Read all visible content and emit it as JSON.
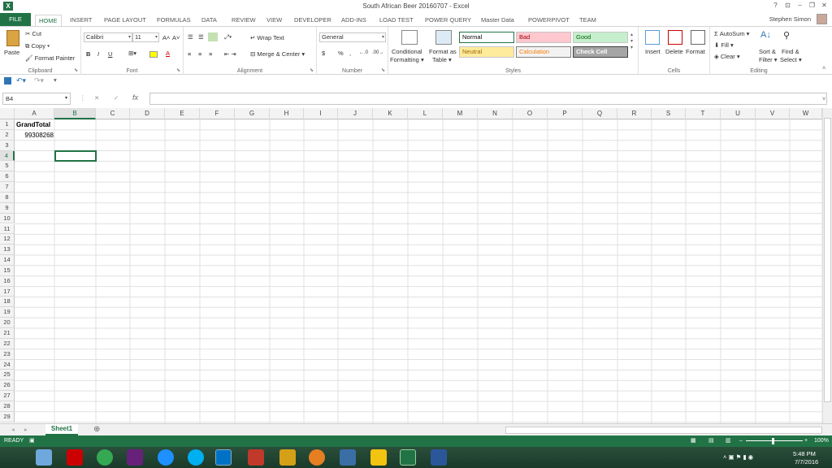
{
  "window": {
    "title": "South African Beer 20160707 - Excel",
    "help": "?",
    "ribbon_display": "⊡",
    "minimize": "–",
    "restore": "❐",
    "close": "✕"
  },
  "tabs": [
    "FILE",
    "HOME",
    "INSERT",
    "PAGE LAYOUT",
    "FORMULAS",
    "DATA",
    "REVIEW",
    "VIEW",
    "DEVELOPER",
    "ADD-INS",
    "LOAD TEST",
    "POWER QUERY",
    "Master Data",
    "POWERPIVOT",
    "TEAM"
  ],
  "user": {
    "name": "Stephen Simon"
  },
  "clipboard": {
    "paste": "Paste",
    "cut": "Cut",
    "copy": "Copy",
    "format_painter": "Format Painter",
    "label": "Clipboard"
  },
  "font": {
    "name": "Calibri",
    "size": "11",
    "bold": "B",
    "italic": "I",
    "underline": "U",
    "grow": "A˄",
    "shrink": "A˅",
    "font_color": "A",
    "label": "Font"
  },
  "alignment": {
    "wrap": "Wrap Text",
    "merge": "Merge & Center",
    "label": "Alignment"
  },
  "number": {
    "format": "General",
    "currency": "$",
    "percent": "%",
    "comma": ",",
    "inc": "←.0",
    "dec": ".00→",
    "label": "Number"
  },
  "styles": {
    "conditional": "Conditional",
    "conditional2": "Formatting",
    "format_as": "Format as",
    "format_as2": "Table",
    "cells": [
      {
        "label": "Normal",
        "bg": "#ffffff",
        "fg": "#000000",
        "border": "#217346"
      },
      {
        "label": "Bad",
        "bg": "#ffc7ce",
        "fg": "#9c0006",
        "border": "#c6c6c6"
      },
      {
        "label": "Good",
        "bg": "#c6efce",
        "fg": "#006100",
        "border": "#c6c6c6"
      },
      {
        "label": "Neutral",
        "bg": "#ffeb9c",
        "fg": "#9c6500",
        "border": "#c6c6c6"
      },
      {
        "label": "Calculation",
        "bg": "#f2f2f2",
        "fg": "#fa7d00",
        "border": "#7f7f7f"
      },
      {
        "label": "Check Cell",
        "bg": "#a5a5a5",
        "fg": "#ffffff",
        "border": "#3f3f3f"
      }
    ],
    "label": "Styles"
  },
  "cells_group": {
    "insert": "Insert",
    "delete": "Delete",
    "format": "Format",
    "label": "Cells"
  },
  "editing": {
    "autosum": "AutoSum",
    "fill": "Fill",
    "clear": "Clear",
    "sort": "Sort &",
    "sort2": "Filter",
    "find": "Find &",
    "find2": "Select",
    "label": "Editing"
  },
  "formula_bar": {
    "name_box": "B4",
    "fx": "fx",
    "cancel": "✕",
    "enter": "✓",
    "formula": ""
  },
  "columns": [
    "A",
    "B",
    "C",
    "D",
    "E",
    "F",
    "G",
    "H",
    "I",
    "J",
    "K",
    "L",
    "M",
    "N",
    "O",
    "P",
    "Q",
    "R",
    "S",
    "T",
    "U",
    "V",
    "W"
  ],
  "rows": [
    "1",
    "2",
    "3",
    "4",
    "5",
    "6",
    "7",
    "8",
    "9",
    "10",
    "11",
    "12",
    "13",
    "14",
    "15",
    "16",
    "17",
    "18",
    "19",
    "20",
    "21",
    "22",
    "23",
    "24",
    "25",
    "26",
    "27",
    "28",
    "29"
  ],
  "cells": {
    "a1": "GrandTotal",
    "a2": "99308268"
  },
  "sheets": {
    "active": "Sheet1",
    "add": "⊕"
  },
  "status": {
    "ready": "READY",
    "zoom": "100%"
  },
  "taskbar": {
    "time": "5:48 PM",
    "date": "7/7/2016"
  }
}
